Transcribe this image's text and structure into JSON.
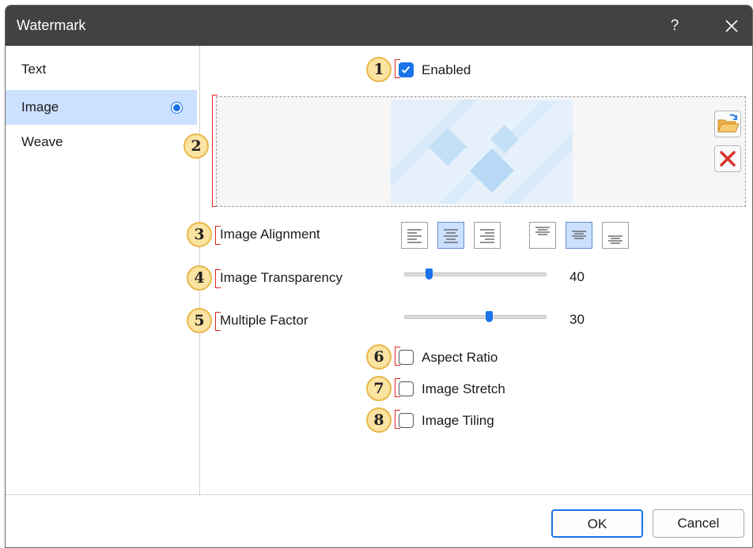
{
  "window": {
    "title": "Watermark",
    "help": "?"
  },
  "sidebar": {
    "items": [
      {
        "label": "Text"
      },
      {
        "label": "Image"
      },
      {
        "label": "Weave"
      }
    ]
  },
  "badges": [
    "1",
    "2",
    "3",
    "4",
    "5",
    "6",
    "7",
    "8"
  ],
  "enabled": {
    "label": "Enabled",
    "checked": true
  },
  "image_alignment": {
    "label": "Image Alignment",
    "horizontal_selected": "center",
    "vertical_selected": "middle"
  },
  "image_transparency": {
    "label": "Image Transparency",
    "value": "40",
    "fraction": 0.17
  },
  "multiple_factor": {
    "label": "Multiple Factor",
    "value": "30",
    "fraction": 0.6
  },
  "aspect_ratio": {
    "label": "Aspect Ratio",
    "checked": false
  },
  "image_stretch": {
    "label": "Image Stretch",
    "checked": false
  },
  "image_tiling": {
    "label": "Image Tiling",
    "checked": false
  },
  "buttons": {
    "ok": "OK",
    "cancel": "Cancel"
  },
  "colors": {
    "accent": "#1a73e8",
    "titlebar": "#424242",
    "selection": "#cce0ff",
    "badge": "#fbe3a2"
  }
}
